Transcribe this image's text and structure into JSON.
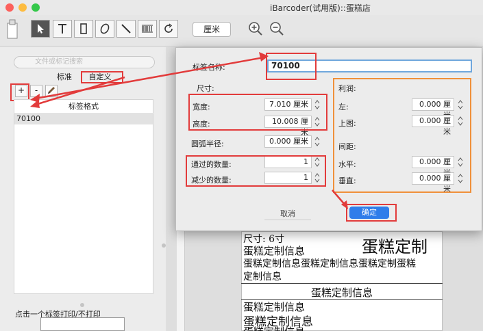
{
  "window": {
    "title": "iBarcoder(试用版)::蛋糕店",
    "unit": "厘米"
  },
  "sidebar": {
    "search_placeholder": "文件或标记搜索",
    "tabs": [
      {
        "label": "标准"
      },
      {
        "label": "自定义"
      }
    ],
    "add_label": "+",
    "remove_label": "-",
    "list_header": "标签格式",
    "items": [
      {
        "label": "70100"
      }
    ],
    "hint": "点击一个标签打印/不打印"
  },
  "dialog": {
    "name_label": "标签名称:",
    "name_value": "70100",
    "size_label": "尺寸:",
    "width_label": "宽度:",
    "width_value": "7.010 厘米",
    "height_label": "高度:",
    "height_value": "10.008 厘米",
    "radius_label": "圆弧半径:",
    "radius_value": "0.000 厘米",
    "across_label": "通过的数量:",
    "across_value": "1",
    "down_label": "减少的数量:",
    "down_value": "1",
    "margin_label": "利润:",
    "left_label": "左:",
    "left_value": "0.000 厘米",
    "top_label": "上图:",
    "top_value": "0.000 厘米",
    "gap_label": "间距:",
    "hgap_label": "水平:",
    "hgap_value": "0.000 厘米",
    "vgap_label": "垂直:",
    "vgap_value": "0.000 厘米",
    "cancel": "取消",
    "ok": "确定"
  },
  "canvas": {
    "size_line": "尺寸: 6寸",
    "title": "蛋糕定制",
    "lines": [
      "蛋糕定制信息",
      "蛋糕定制信息蛋糕定制信息蛋糕定制蛋糕",
      "定制信息"
    ],
    "section2_title": "蛋糕定制信息",
    "section2_lines": [
      "蛋糕定制信息",
      "蛋糕定制信息",
      "蛋糕定制信息"
    ]
  },
  "colors": {
    "accent": "#2f7dea",
    "annotation_red": "#e23b3b",
    "annotation_orange": "#f0903a"
  }
}
